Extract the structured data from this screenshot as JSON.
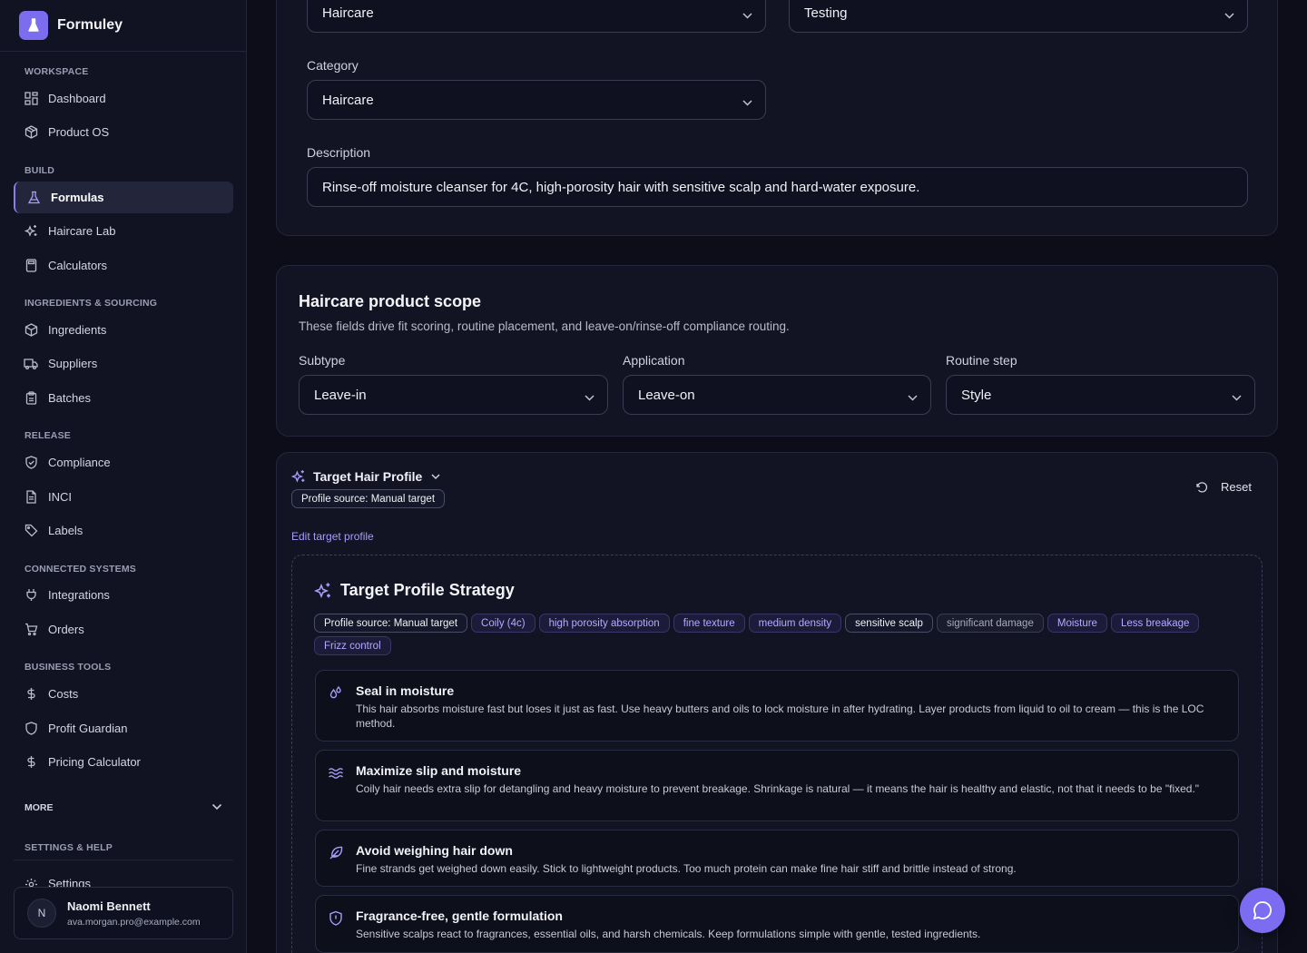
{
  "app": {
    "name": "Formuley"
  },
  "sidebar": {
    "sections": {
      "workspace": "WORKSPACE",
      "build": "BUILD",
      "ingredients": "INGREDIENTS & SOURCING",
      "release": "RELEASE",
      "connected": "CONNECTED SYSTEMS",
      "business": "BUSINESS TOOLS",
      "more": "MORE",
      "settings_help": "SETTINGS & HELP"
    },
    "items": {
      "dashboard": "Dashboard",
      "product_os": "Product OS",
      "formulas": "Formulas",
      "haircare_lab": "Haircare Lab",
      "calculators": "Calculators",
      "ingredients": "Ingredients",
      "suppliers": "Suppliers",
      "batches": "Batches",
      "compliance": "Compliance",
      "inci": "INCI",
      "labels": "Labels",
      "integrations": "Integrations",
      "orders": "Orders",
      "costs": "Costs",
      "profit_guardian": "Profit Guardian",
      "pricing_calculator": "Pricing Calculator",
      "settings": "Settings"
    },
    "active": "Formulas",
    "user": {
      "initial": "N",
      "name": "Naomi Bennett",
      "email": "ava.morgan.pro@example.com"
    }
  },
  "details": {
    "top_select_1": "Haircare",
    "top_select_2": "Testing",
    "category_label": "Category",
    "category_value": "Haircare",
    "description_label": "Description",
    "description_value": "Rinse-off moisture cleanser for 4C, high-porosity hair with sensitive scalp and hard-water exposure."
  },
  "scope": {
    "title": "Haircare product scope",
    "subtitle": "These fields drive fit scoring, routine placement, and leave-on/rinse-off compliance routing.",
    "subtype_label": "Subtype",
    "subtype_value": "Leave-in",
    "application_label": "Application",
    "application_value": "Leave-on",
    "routine_label": "Routine step",
    "routine_value": "Style"
  },
  "profile": {
    "title": "Target Hair Profile",
    "source_badge": "Profile source: Manual target",
    "reset_label": "Reset",
    "edit_link": "Edit target profile",
    "strategy_title": "Target Profile Strategy",
    "tags": [
      {
        "label": "Profile source: Manual target",
        "style": "plain"
      },
      {
        "label": "Coily (4c)",
        "style": "purple"
      },
      {
        "label": "high porosity absorption",
        "style": "purple"
      },
      {
        "label": "fine texture",
        "style": "purple"
      },
      {
        "label": "medium density",
        "style": "purple"
      },
      {
        "label": "sensitive scalp",
        "style": "plain"
      },
      {
        "label": "significant damage",
        "style": "grey"
      },
      {
        "label": "Moisture",
        "style": "purple"
      },
      {
        "label": "Less breakage",
        "style": "purple"
      },
      {
        "label": "Frizz control",
        "style": "purple"
      }
    ],
    "tips": [
      {
        "icon": "droplets-icon",
        "title": "Seal in moisture",
        "body": "This hair absorbs moisture fast but loses it just as fast. Use heavy butters and oils to lock moisture in after hydrating. Layer products from liquid to oil to cream — this is the LOC method."
      },
      {
        "icon": "waves-icon",
        "title": "Maximize slip and moisture",
        "body": "Coily hair needs extra slip for detangling and heavy moisture to prevent breakage. Shrinkage is natural — it means the hair is healthy and elastic, not that it needs to be \"fixed.\""
      },
      {
        "icon": "feather-icon",
        "title": "Avoid weighing hair down",
        "body": "Fine strands get weighed down easily. Stick to lightweight products. Too much protein can make fine hair stiff and brittle instead of strong."
      },
      {
        "icon": "shield-alert-icon",
        "title": "Fragrance-free, gentle formulation",
        "body": "Sensitive scalps react to fragrances, essential oils, and harsh chemicals. Keep formulations simple with gentle, tested ingredients."
      }
    ]
  },
  "colors": {
    "accent": "#7c6cf2",
    "background": "#0c0d19",
    "card": "#121424"
  }
}
